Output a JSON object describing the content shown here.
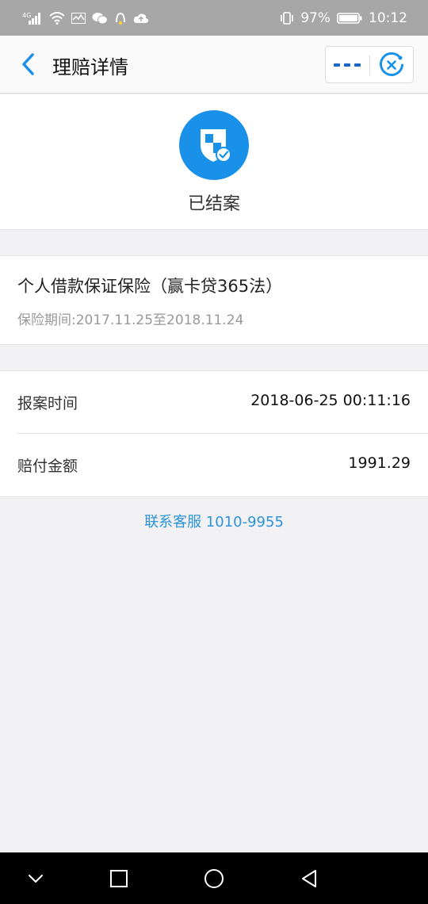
{
  "status_bar": {
    "network": "4G",
    "battery": "97%",
    "time": "10:12"
  },
  "header": {
    "title": "理赔详情",
    "back_icon": "chevron-left-icon",
    "more_icon": "more-dots-icon",
    "close_icon": "close-circle-icon"
  },
  "claim_status": {
    "icon": "shield-check-icon",
    "text": "已结案"
  },
  "policy": {
    "name": "个人借款保证保险（赢卡贷365法）",
    "period": "保险期间:2017.11.25至2018.11.24"
  },
  "details": [
    {
      "label": "报案时间",
      "value": "2018-06-25 00:11:16"
    },
    {
      "label": "赔付金额",
      "value": "1991.29"
    }
  ],
  "contact": {
    "text": "联系客服 1010-9955"
  },
  "colors": {
    "accent": "#1a91e8",
    "link": "#2d93d8",
    "status_bar_bg": "#a7a7a7",
    "page_bg": "#f2f2f4"
  }
}
